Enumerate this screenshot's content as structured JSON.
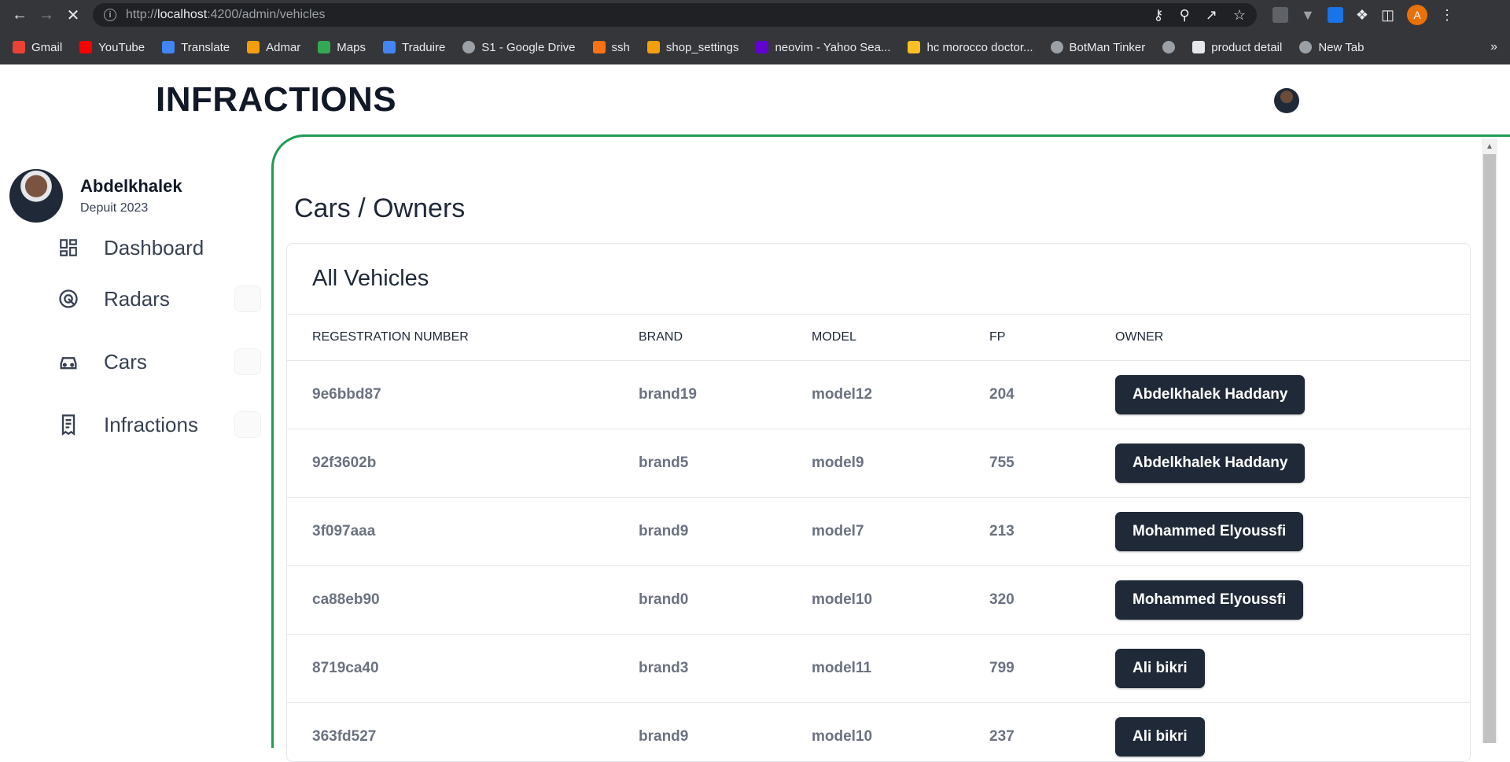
{
  "browser": {
    "url_prefix": "http://",
    "url_host": "localhost",
    "url_rest": ":4200/admin/vehicles",
    "profile_initial": "A",
    "bookmarks": [
      {
        "label": "Gmail",
        "color": "#ea4335"
      },
      {
        "label": "YouTube",
        "color": "#ff0000"
      },
      {
        "label": "Translate",
        "color": "#4285f4"
      },
      {
        "label": "Admar",
        "color": "#f59e0b"
      },
      {
        "label": "Maps",
        "color": "#34a853"
      },
      {
        "label": "Traduire",
        "color": "#4285f4"
      },
      {
        "label": "S1 - Google Drive",
        "color": "#9aa0a6"
      },
      {
        "label": "ssh",
        "color": "#f97316"
      },
      {
        "label": "shop_settings",
        "color": "#f59e0b"
      },
      {
        "label": "neovim - Yahoo Sea...",
        "color": "#6001d2"
      },
      {
        "label": "hc morocco doctor...",
        "color": "#fbbf24"
      },
      {
        "label": "BotMan Tinker",
        "color": "#9aa0a6"
      },
      {
        "label": "",
        "color": "#9aa0a6"
      },
      {
        "label": "product detail",
        "color": "#e5e7eb"
      },
      {
        "label": "New Tab",
        "color": "#9aa0a6"
      }
    ],
    "more": "»"
  },
  "app": {
    "title": "INFRACTIONS"
  },
  "user": {
    "name": "Abdelkhalek",
    "since": "Depuit 2023"
  },
  "sidebar": {
    "items": [
      {
        "label": "Dashboard",
        "icon": "dashboard-icon"
      },
      {
        "label": "Radars",
        "icon": "radar-icon"
      },
      {
        "label": "Cars",
        "icon": "car-icon"
      },
      {
        "label": "Infractions",
        "icon": "receipt-icon"
      }
    ]
  },
  "main": {
    "page_title": "Cars / Owners",
    "card_title": "All Vehicles",
    "columns": [
      "REGESTRATION NUMBER",
      "BRAND",
      "MODEL",
      "FP",
      "OWNER"
    ],
    "rows": [
      {
        "reg": "9e6bbd87",
        "brand": "brand19",
        "model": "model12",
        "fp": "204",
        "owner": "Abdelkhalek Haddany"
      },
      {
        "reg": "92f3602b",
        "brand": "brand5",
        "model": "model9",
        "fp": "755",
        "owner": "Abdelkhalek Haddany"
      },
      {
        "reg": "3f097aaa",
        "brand": "brand9",
        "model": "model7",
        "fp": "213",
        "owner": "Mohammed Elyoussfi"
      },
      {
        "reg": "ca88eb90",
        "brand": "brand0",
        "model": "model10",
        "fp": "320",
        "owner": "Mohammed Elyoussfi"
      },
      {
        "reg": "8719ca40",
        "brand": "brand3",
        "model": "model11",
        "fp": "799",
        "owner": "Ali bikri"
      },
      {
        "reg": "363fd527",
        "brand": "brand9",
        "model": "model10",
        "fp": "237",
        "owner": "Ali bikri"
      }
    ]
  },
  "colors": {
    "accent": "#1f9d55",
    "button_bg": "#1f2937"
  }
}
